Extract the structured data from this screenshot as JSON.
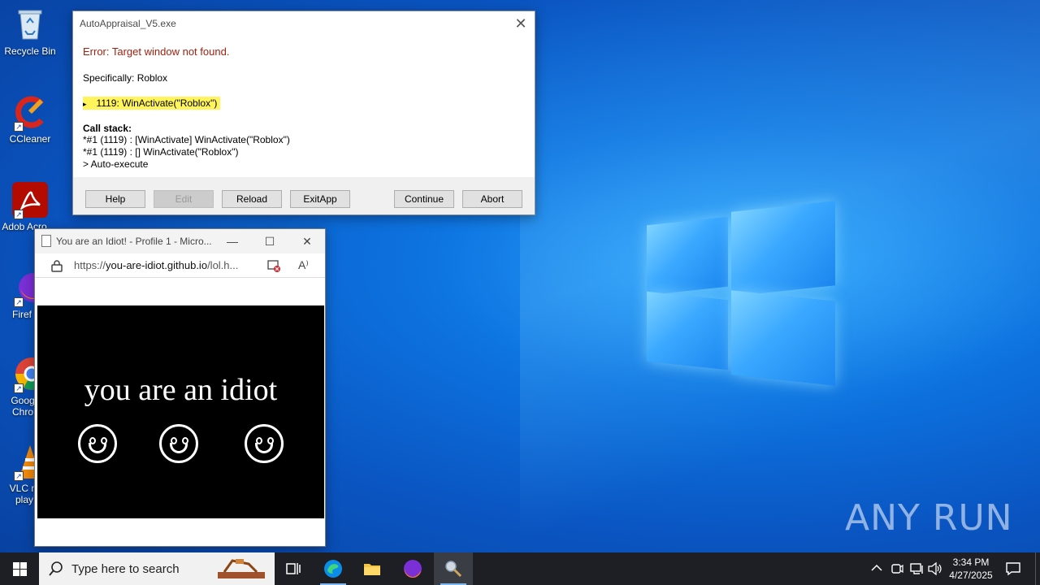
{
  "desktop": {
    "icons": [
      {
        "label": "Recycle Bin"
      },
      {
        "label": "CCleaner"
      },
      {
        "label": "Adob Acro"
      },
      {
        "label": "Firef"
      },
      {
        "label": "Goog Chro"
      },
      {
        "label": "VLC m play"
      }
    ]
  },
  "dialog": {
    "title": "AutoAppraisal_V5.exe",
    "close": "✕",
    "error": "Error: Target window not found.",
    "specifically": "Specifically: Roblox",
    "line_marker": "▸",
    "line": "1119: WinActivate(\"Roblox\")",
    "callstack_title": "Call stack:",
    "callstack": [
      "*#1 (1119) : [WinActivate] WinActivate(\"Roblox\")",
      "*#1 (1119) : [] WinActivate(\"Roblox\")",
      "> Auto-execute"
    ],
    "buttons": {
      "help": "Help",
      "edit": "Edit",
      "reload": "Reload",
      "exitapp": "ExitApp",
      "continue": "Continue",
      "abort": "Abort"
    }
  },
  "browser": {
    "tab_title": "You are an Idiot! - Profile 1 - Micro...",
    "minimize": "—",
    "maximize": "☐",
    "close": "✕",
    "url_prefix": "https://",
    "url_host": "you-are-idiot.github.io",
    "url_path": "/lol.h...",
    "read_aloud": "A⁾",
    "page_text": "you are an idiot"
  },
  "watermark": "ANY RUN",
  "taskbar": {
    "search_placeholder": "Type here to search",
    "time": "3:34 PM",
    "date": "4/27/2025"
  },
  "colors": {
    "error_text": "#a4200f",
    "highlight": "#fff45c",
    "taskbar": "#1d1f24"
  }
}
